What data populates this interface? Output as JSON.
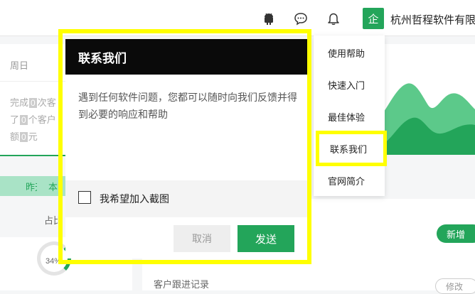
{
  "header": {
    "company_badge": "企",
    "company_name": "杭州哲程软件有限",
    "icons": [
      "android-icon",
      "chat-icon",
      "bell-icon"
    ]
  },
  "background": {
    "day_label": "周日",
    "stats": {
      "line1_prefix": "完成",
      "line1_value": "0",
      "line1_suffix": "次客",
      "line2_prefix": "了",
      "line2_value": "0",
      "line2_suffix": "个客户",
      "line3_prefix": "额",
      "line3_value": "0",
      "line3_suffix": "元"
    },
    "range_tabs": [
      "昨天",
      "本"
    ],
    "ratio_label": "占比",
    "donut_percent": "34%",
    "new_button": "新增",
    "followup_title": "客户跟进记录",
    "edit_button": "修改"
  },
  "help_menu": {
    "items": [
      "使用帮助",
      "快速入门",
      "最佳体验",
      "联系我们",
      "官网简介"
    ],
    "active_index": 3
  },
  "dialog": {
    "title": "联系我们",
    "message": "遇到任何软件问题，您都可以随时向我们反馈并得到必要的响应和帮助",
    "checkbox_label": "我希望加入截图",
    "checkbox_checked": false,
    "cancel_label": "取消",
    "send_label": "发送"
  },
  "colors": {
    "accent": "#23a55a",
    "highlight": "#ffff00",
    "dialog_header": "#0a0a0a",
    "tab_bg": "#a9e3c6"
  }
}
